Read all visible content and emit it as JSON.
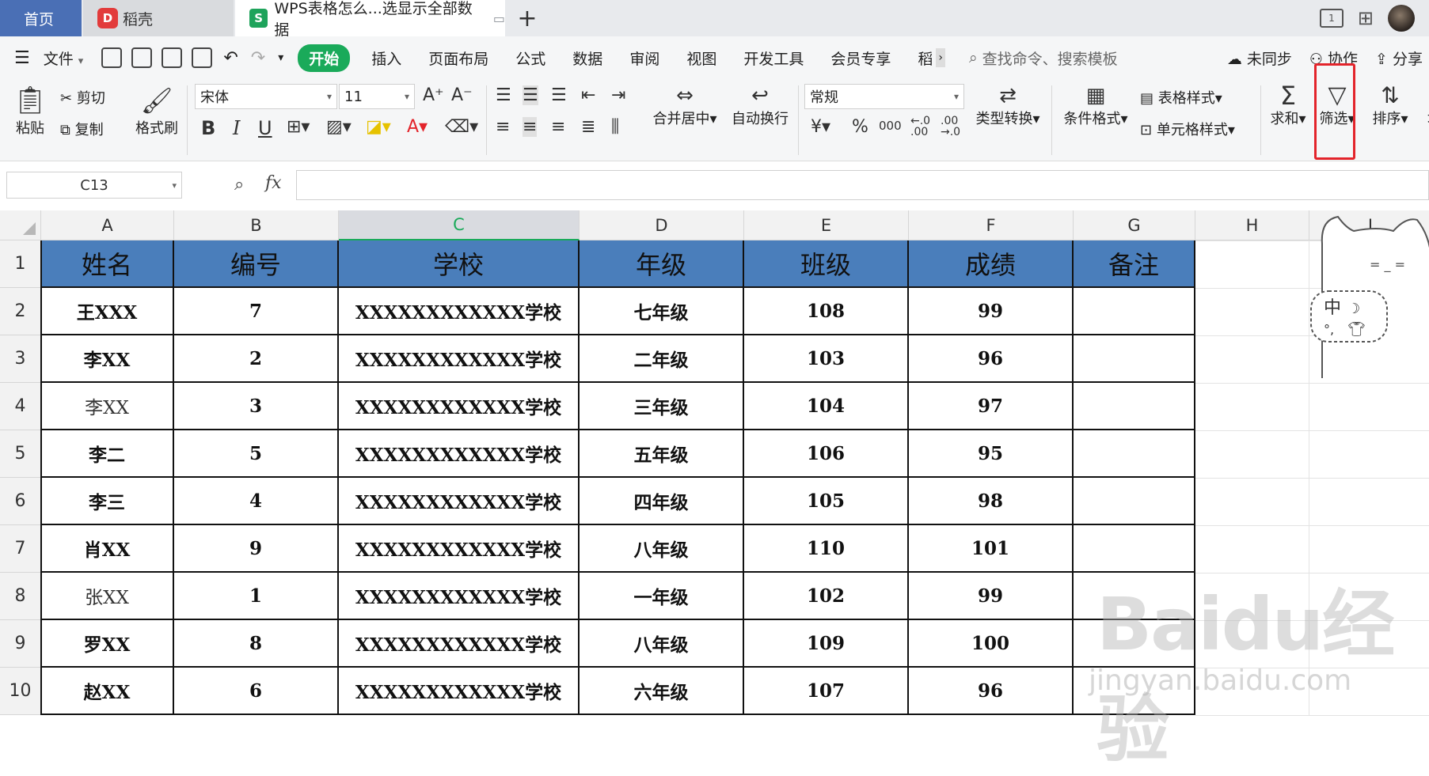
{
  "tabs": {
    "home": "首页",
    "docer": "稻壳",
    "doc": "WPS表格怎么...选显示全部数据",
    "add": "+"
  },
  "menu": {
    "file": "文件",
    "items": [
      "开始",
      "插入",
      "页面布局",
      "公式",
      "数据",
      "审阅",
      "视图",
      "开发工具",
      "会员专享",
      "稻"
    ],
    "search_placeholder": "查找命令、搜索模板",
    "sync": "未同步",
    "collab": "协作",
    "share": "分享"
  },
  "ribbon": {
    "paste": "粘贴",
    "cut": "剪切",
    "copy": "复制",
    "format_painter": "格式刷",
    "font": "宋体",
    "font_size": "11",
    "bold": "B",
    "italic": "I",
    "underline": "U",
    "merge": "合并居中",
    "wrap": "自动换行",
    "number_format": "常规",
    "currency": "¥",
    "percent": "%",
    "thousands": "000",
    "type_convert": "类型转换",
    "cond_format": "条件格式",
    "table_style": "表格样式",
    "cell_style": "单元格样式",
    "sum": "求和",
    "filter": "筛选",
    "sort": "排序",
    "fill": "填"
  },
  "formula_bar": {
    "name_box": "C13",
    "fx": "fx"
  },
  "sheet": {
    "columns": [
      "A",
      "B",
      "C",
      "D",
      "E",
      "F",
      "G",
      "H",
      "I"
    ],
    "selected_column": "C",
    "rows": [
      "1",
      "2",
      "3",
      "4",
      "5",
      "6",
      "7",
      "8",
      "9",
      "10"
    ],
    "header": [
      "姓名",
      "编号",
      "学校",
      "年级",
      "班级",
      "成绩",
      "备注"
    ],
    "data": [
      [
        "王XXX",
        "7",
        "XXXXXXXXXXXX学校",
        "七年级",
        "108",
        "99",
        ""
      ],
      [
        "李XX",
        "2",
        "XXXXXXXXXXXX学校",
        "二年级",
        "103",
        "96",
        ""
      ],
      [
        "李XX",
        "3",
        "XXXXXXXXXXXX学校",
        "三年级",
        "104",
        "97",
        ""
      ],
      [
        "李二",
        "5",
        "XXXXXXXXXXXX学校",
        "五年级",
        "106",
        "95",
        ""
      ],
      [
        "李三",
        "4",
        "XXXXXXXXXXXX学校",
        "四年级",
        "105",
        "98",
        ""
      ],
      [
        "肖XX",
        "9",
        "XXXXXXXXXXXX学校",
        "八年级",
        "110",
        "101",
        ""
      ],
      [
        "张XX",
        "1",
        "XXXXXXXXXXXX学校",
        "一年级",
        "102",
        "99",
        ""
      ],
      [
        "罗XX",
        "8",
        "XXXXXXXXXXXX学校",
        "八年级",
        "109",
        "100",
        ""
      ],
      [
        "赵XX",
        "6",
        "XXXXXXXXXXXX学校",
        "六年级",
        "107",
        "96",
        ""
      ]
    ]
  },
  "overlay": {
    "ime_label": "中",
    "watermark": "Baidu经验",
    "watermark_url": "jingyan.baidu.com"
  },
  "colors": {
    "header_fill": "#4a7ebb",
    "accent_green": "#1aaa5a",
    "highlight_red": "#e3242b",
    "home_tab": "#4a6fb5"
  }
}
